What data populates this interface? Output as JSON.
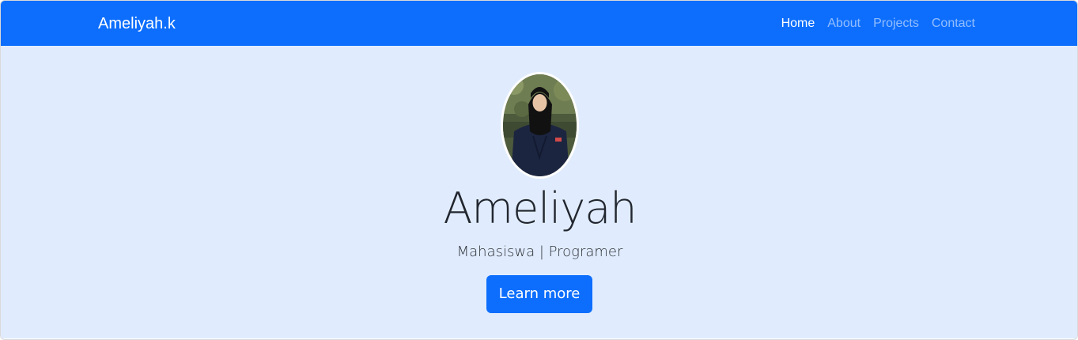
{
  "navbar": {
    "brand": "Ameliyah.k",
    "links": [
      {
        "label": "Home",
        "active": true
      },
      {
        "label": "About",
        "active": false
      },
      {
        "label": "Projects",
        "active": false
      },
      {
        "label": "Contact",
        "active": false
      }
    ],
    "color": "#0d6efd"
  },
  "hero": {
    "avatar_icon": "profile-photo",
    "title": "Ameliyah",
    "subtitle": "Mahasiswa | Programer",
    "button_label": "Learn more",
    "background": "#e0ecfe"
  }
}
